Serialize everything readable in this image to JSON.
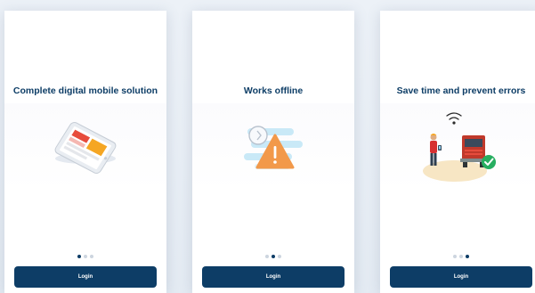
{
  "screens": [
    {
      "title": "Complete digital mobile solution",
      "illustration": "mobile-phone-icon",
      "active_dot": 0,
      "button_label": "Login"
    },
    {
      "title": "Works offline",
      "illustration": "warning-offline-icon",
      "active_dot": 1,
      "button_label": "Login"
    },
    {
      "title": "Save time and prevent errors",
      "illustration": "worker-truck-check-icon",
      "active_dot": 2,
      "button_label": "Login"
    }
  ],
  "colors": {
    "primary": "#0d3d66",
    "dot_inactive": "#cdd5df",
    "warning": "#f2994a",
    "success": "#27ae60"
  }
}
